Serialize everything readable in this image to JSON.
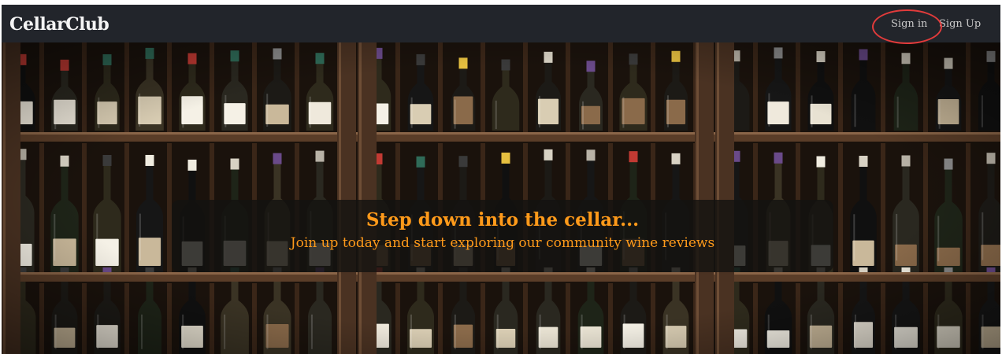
{
  "nav": {
    "brand": "CellarClub",
    "sign_in_label": "Sign in",
    "sign_up_label": "Sign Up"
  },
  "hero": {
    "title": "Step down into the cellar...",
    "subtitle": "Join up today and start exploring our community wine reviews"
  },
  "colors": {
    "navbar_bg": "#22252b",
    "accent_orange": "#ff9a1a",
    "shelf_wood": "#4a3222",
    "highlight_ring": "#e23b3b"
  }
}
